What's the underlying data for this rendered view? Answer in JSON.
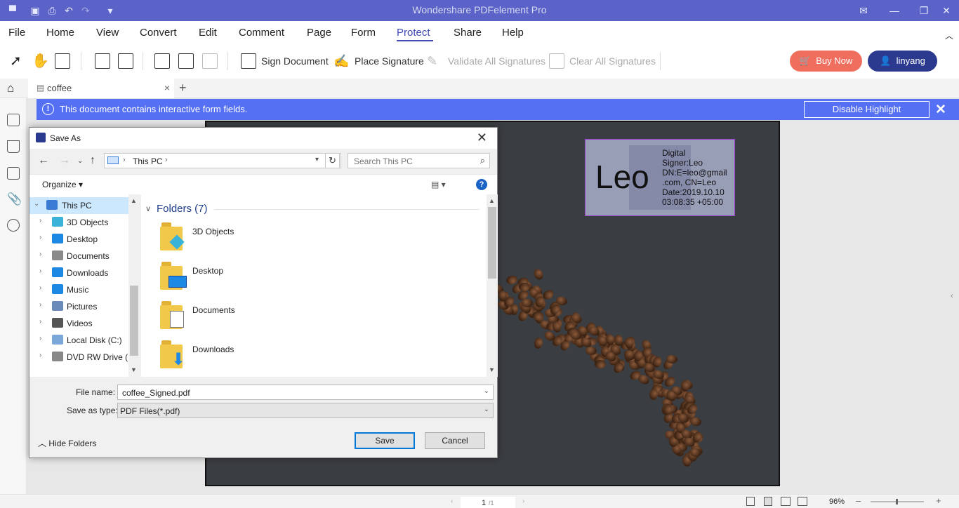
{
  "app": {
    "title": "Wondershare PDFelement Pro"
  },
  "menu": [
    "File",
    "Home",
    "View",
    "Convert",
    "Edit",
    "Comment",
    "Page",
    "Form",
    "Protect",
    "Share",
    "Help"
  ],
  "menu_active": "Protect",
  "toolbar": {
    "sign_document": "Sign Document",
    "place_signature": "Place Signature",
    "validate_all": "Validate All Signatures",
    "clear_all": "Clear All Signatures",
    "buy_now": "Buy Now",
    "user": "linyang"
  },
  "tab": {
    "name": "coffee"
  },
  "notice": {
    "text": "This document contains interactive form fields.",
    "button": "Disable Highlight"
  },
  "signature": {
    "name": "Leo",
    "details": [
      "Digital",
      "Signer:Leo",
      "DN:E=leo@gmail",
      ".com, CN=Leo",
      "Date:2019.10.10",
      " 03:08:35 +05:00"
    ]
  },
  "dialog": {
    "title": "Save As",
    "path": "This PC",
    "search_placeholder": "Search This PC",
    "organize": "Organize",
    "tree": [
      {
        "label": "This PC",
        "icon": "computer-icon",
        "selected": true
      },
      {
        "label": "3D Objects",
        "icon": "3d-objects-icon"
      },
      {
        "label": "Desktop",
        "icon": "desktop-icon"
      },
      {
        "label": "Documents",
        "icon": "documents-icon"
      },
      {
        "label": "Downloads",
        "icon": "downloads-icon"
      },
      {
        "label": "Music",
        "icon": "music-icon"
      },
      {
        "label": "Pictures",
        "icon": "pictures-icon"
      },
      {
        "label": "Videos",
        "icon": "videos-icon"
      },
      {
        "label": "Local Disk (C:)",
        "icon": "local-disk-icon"
      },
      {
        "label": "DVD RW Drive (D",
        "icon": "dvd-drive-icon"
      }
    ],
    "group_header": "Folders (7)",
    "folders": [
      "3D Objects",
      "Desktop",
      "Documents",
      "Downloads"
    ],
    "file_name_label": "File name:",
    "file_name": "coffee_Signed.pdf",
    "save_type_label": "Save as type:",
    "save_type": "PDF Files(*.pdf)",
    "save": "Save",
    "cancel": "Cancel",
    "hide_folders": "Hide Folders"
  },
  "status": {
    "page": "1",
    "total": "/1",
    "zoom": "96%"
  },
  "colors": {
    "titlebar": "#5b63c8",
    "notice": "#5670f4",
    "accent": "#3f4ab6",
    "buy": "#ef6e5e",
    "user": "#2b3a8f"
  }
}
